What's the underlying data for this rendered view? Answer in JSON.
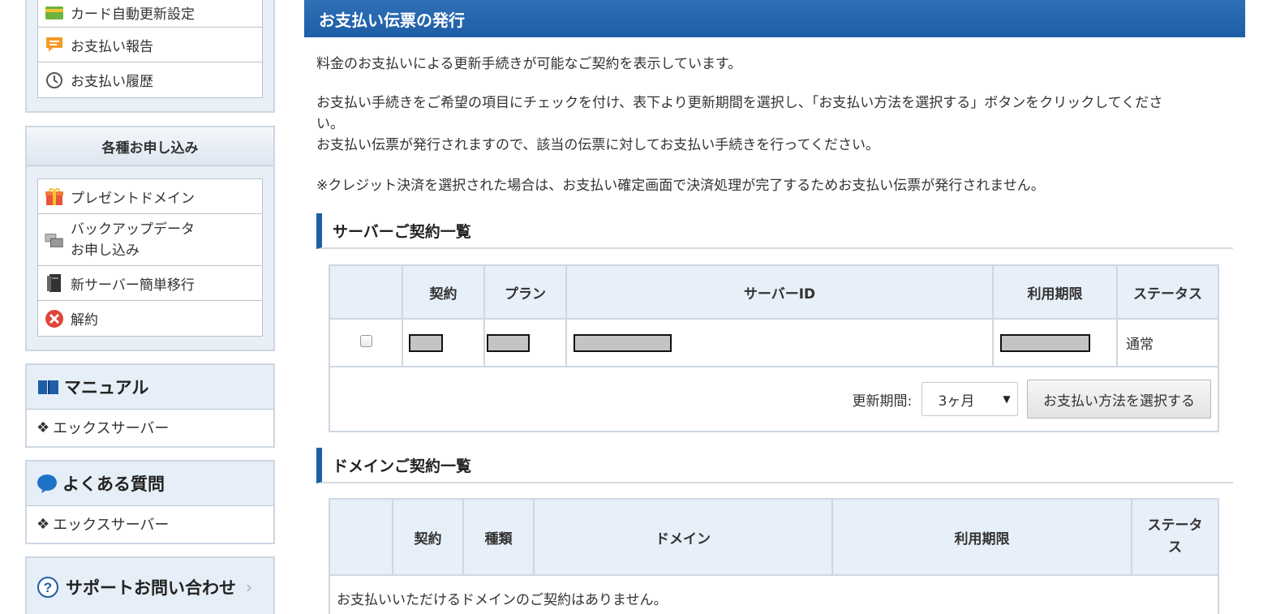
{
  "sidebar": {
    "top_items": [
      {
        "label": "カード自動更新設定",
        "icon": "card-icon"
      },
      {
        "label": "お支払い報告",
        "icon": "speech-bubble-icon"
      },
      {
        "label": "お支払い履歴",
        "icon": "clock-icon"
      }
    ],
    "apply_panel": {
      "title": "各種お申し込み",
      "items": [
        {
          "label": "プレゼントドメイン",
          "icon": "gift-icon"
        },
        {
          "label_line1": "バックアップデータ",
          "label_line2": "お申し込み",
          "icon": "backup-icon"
        },
        {
          "label": "新サーバー簡単移行",
          "icon": "server-icon"
        },
        {
          "label": "解約",
          "icon": "cancel-icon"
        }
      ]
    },
    "manual": {
      "title": "マニュアル",
      "icon": "book-icon",
      "item": "エックスサーバー"
    },
    "faq": {
      "title": "よくある質問",
      "icon": "chat-icon",
      "item": "エックスサーバー"
    },
    "support": {
      "title": "サポートお問い合わせ",
      "icon": "question-icon"
    }
  },
  "main": {
    "title": "お支払い伝票の発行",
    "para1": "料金のお支払いによる更新手続きが可能なご契約を表示しています。",
    "para2_line1": "お支払い手続きをご希望の項目にチェックを付け、表下より更新期間を選択し、「お支払い方法を選択する」ボタンをクリックしてくださ",
    "para2_line2": "い。",
    "para2_line3": "お支払い伝票が発行されますので、該当の伝票に対してお支払い手続きを行ってください。",
    "para3": "※クレジット決済を選択された場合は、お支払い確定画面で決済処理が完了するためお支払い伝票が発行されません。",
    "server_section": {
      "title": "サーバーご契約一覧",
      "headers": [
        "",
        "契約",
        "プラン",
        "サーバーID",
        "利用期限",
        "ステータス"
      ],
      "row": {
        "status": "通常"
      },
      "renew_label": "更新期間:",
      "renew_value": "3ヶ月",
      "button": "お支払い方法を選択する"
    },
    "domain_section": {
      "title": "ドメインご契約一覧",
      "headers": [
        "",
        "契約",
        "種類",
        "ドメイン",
        "利用期限",
        "ステータス"
      ],
      "status_line1": "ステータ",
      "status_line2": "ス",
      "empty": "お支払いいただけるドメインのご契約はありません。"
    }
  }
}
